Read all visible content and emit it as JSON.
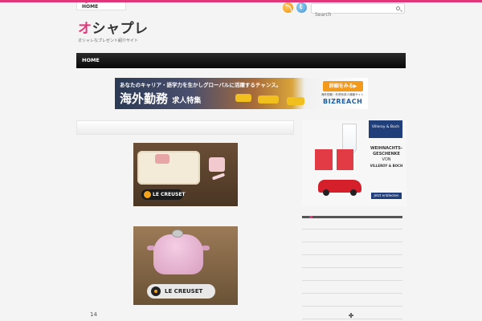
{
  "top_nav": {
    "home_label": "HOME"
  },
  "search": {
    "placeholder": "Search"
  },
  "site": {
    "title_first": "オ",
    "title_rest": "シャプレ",
    "subtitle": "オシャレなプレゼント紹介サイト"
  },
  "main_nav": {
    "home_label": "HOME"
  },
  "banner": {
    "line1": "あなたのキャリア・語学力を生かしグローバルに活躍するチャンス。",
    "big_text": "海外勤務",
    "small_text": "求人特集",
    "cta_label": "詳細をみる▶",
    "caption": "海外勤務・外資系求人情報サイト",
    "brand": "BIZREACH"
  },
  "products": [
    {
      "brand": "LE CREUSET"
    },
    {
      "brand": "LE CREUSET"
    }
  ],
  "pagination": {
    "page": "14"
  },
  "sidebar_ad": {
    "brand": "Villeroy & Boch",
    "headline_1": "WEIHNACHTS-",
    "headline_2": "GESCHENKE",
    "headline_3": "VON",
    "headline_4": "VILLEROY & BOCH",
    "cta": "Jetzt entdecken"
  },
  "colors": {
    "accent": "#e2367a",
    "nav_bg": "#111111",
    "background": "#f4f4f4"
  }
}
